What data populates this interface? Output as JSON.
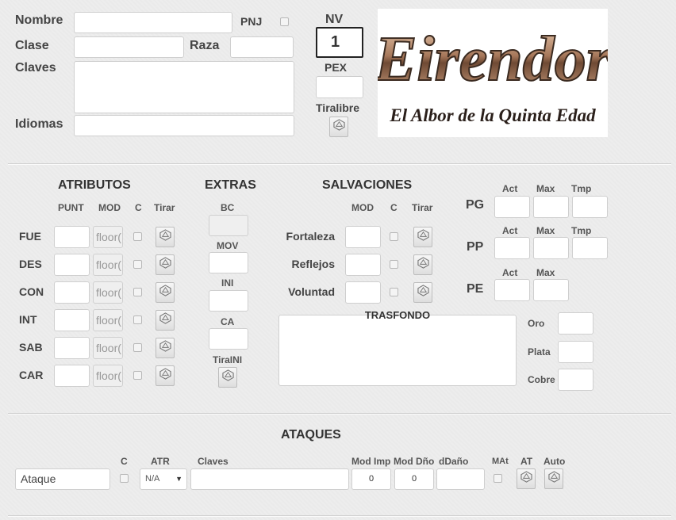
{
  "identity": {
    "nombre_label": "Nombre",
    "clase_label": "Clase",
    "raza_label": "Raza",
    "claves_label": "Claves",
    "idiomas_label": "Idiomas",
    "pnj_label": "PNJ",
    "nv_label": "NV",
    "nv_value": "1",
    "pex_label": "PEX",
    "tiralibre_label": "Tiralibre"
  },
  "logo": {
    "title": "Eirendor",
    "subtitle": "El Albor de la Quinta Edad"
  },
  "atributos": {
    "title": "ATRIBUTOS",
    "col_punt": "PUNT",
    "col_mod": "MOD",
    "col_c": "C",
    "col_tirar": "Tirar",
    "mod_text": "floor(",
    "rows": [
      "FUE",
      "DES",
      "CON",
      "INT",
      "SAB",
      "CAR"
    ]
  },
  "extras": {
    "title": "EXTRAS",
    "bc": "BC",
    "mov": "MOV",
    "ini": "INI",
    "ca": "CA",
    "tiraini": "TiraINI"
  },
  "salvaciones": {
    "title": "SALVACIONES",
    "col_mod": "MOD",
    "col_c": "C",
    "col_tirar": "Tirar",
    "rows": [
      "Fortaleza",
      "Reflejos",
      "Voluntad"
    ]
  },
  "stats": {
    "pg": "PG",
    "pp": "PP",
    "pe": "PE",
    "act": "Act",
    "max": "Max",
    "tmp": "Tmp"
  },
  "trasfondo": {
    "title": "TRASFONDO"
  },
  "monedas": {
    "oro": "Oro",
    "plata": "Plata",
    "cobre": "Cobre"
  },
  "ataques": {
    "title": "ATAQUES",
    "col_c": "C",
    "col_atr": "ATR",
    "col_claves": "Claves",
    "col_mod_imp": "Mod Imp",
    "col_mod_dno": "Mod Dño",
    "col_ddano": "dDaño",
    "col_mat": "MAt",
    "col_at": "AT",
    "col_auto": "Auto",
    "name_value": "Ataque",
    "atr_value": "N/A",
    "mod_imp_value": "0",
    "mod_dno_value": "0"
  },
  "icons": {
    "roll": "dice-icon"
  },
  "colors": {
    "background": "#ededed",
    "border": "#cfcfcf",
    "label": "#444444"
  }
}
